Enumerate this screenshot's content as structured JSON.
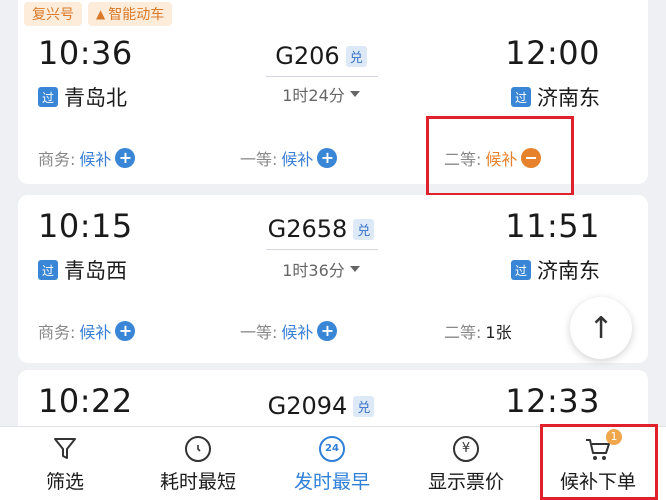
{
  "trains": [
    {
      "tags": [
        "复兴号",
        "智能动车"
      ],
      "dep_time": "10:36",
      "arr_time": "12:00",
      "train_no": "G206",
      "dui": "兑",
      "duration": "1时24分",
      "dep_station": "青岛北",
      "arr_station": "济南东",
      "guo": "过",
      "seats": [
        {
          "label": "商务:",
          "value": "候补"
        },
        {
          "label": "一等:",
          "value": "候补"
        },
        {
          "label": "二等:",
          "value": "候补"
        }
      ]
    },
    {
      "dep_time": "10:15",
      "arr_time": "11:51",
      "train_no": "G2658",
      "dui": "兑",
      "duration": "1时36分",
      "dep_station": "青岛西",
      "arr_station": "济南东",
      "guo": "过",
      "seats": [
        {
          "label": "商务:",
          "value": "候补"
        },
        {
          "label": "一等:",
          "value": "候补"
        },
        {
          "label": "二等:",
          "value": "1张"
        }
      ]
    },
    {
      "dep_time": "10:22",
      "arr_time": "12:33",
      "train_no": "G2094",
      "dui": "兑"
    }
  ],
  "scroll_top_glyph": "↑",
  "bottom_nav": {
    "filter": "筛选",
    "shortest": "耗时最短",
    "earliest": "发时最早",
    "earliest_icon_text": "24",
    "show_price": "显示票价",
    "price_icon_text": "¥",
    "waitlist_order": "候补下单",
    "cart_count": "1"
  },
  "colors": {
    "accent_blue": "#3a86d6",
    "waitlist_orange": "#e6822c",
    "highlight_red": "#e0202a"
  }
}
